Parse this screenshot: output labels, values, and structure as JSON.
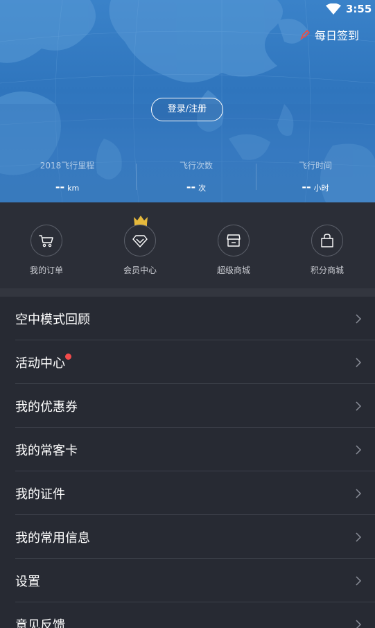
{
  "status_bar": {
    "time": "3:55",
    "wifi_icon": "wifi-icon"
  },
  "header": {
    "checkin_label": "每日签到",
    "checkin_icon": "pen-icon",
    "login_label": "登录/注册",
    "stats": [
      {
        "label": "2018飞行里程",
        "value": "--",
        "unit": "km"
      },
      {
        "label": "飞行次数",
        "value": "--",
        "unit": "次"
      },
      {
        "label": "飞行时间",
        "value": "--",
        "unit": "小时"
      }
    ]
  },
  "quick_nav": [
    {
      "label": "我的订单",
      "icon": "cart-icon"
    },
    {
      "label": "会员中心",
      "icon": "diamond-icon",
      "badge_icon": "crown-icon"
    },
    {
      "label": "超级商城",
      "icon": "store-icon"
    },
    {
      "label": "积分商城",
      "icon": "shopping-bag-icon"
    }
  ],
  "menu": [
    {
      "label": "空中模式回顾"
    },
    {
      "label": "活动中心",
      "has_red_dot": true
    },
    {
      "label": "我的优惠券"
    },
    {
      "label": "我的常客卡"
    },
    {
      "label": "我的证件"
    },
    {
      "label": "我的常用信息"
    },
    {
      "label": "设置"
    },
    {
      "label": "意见反馈"
    }
  ],
  "colors": {
    "header_blue": "#2f75bd",
    "background": "#272a33",
    "accent_red": "#f24b4b",
    "crown_gold": "#e6b93c"
  }
}
